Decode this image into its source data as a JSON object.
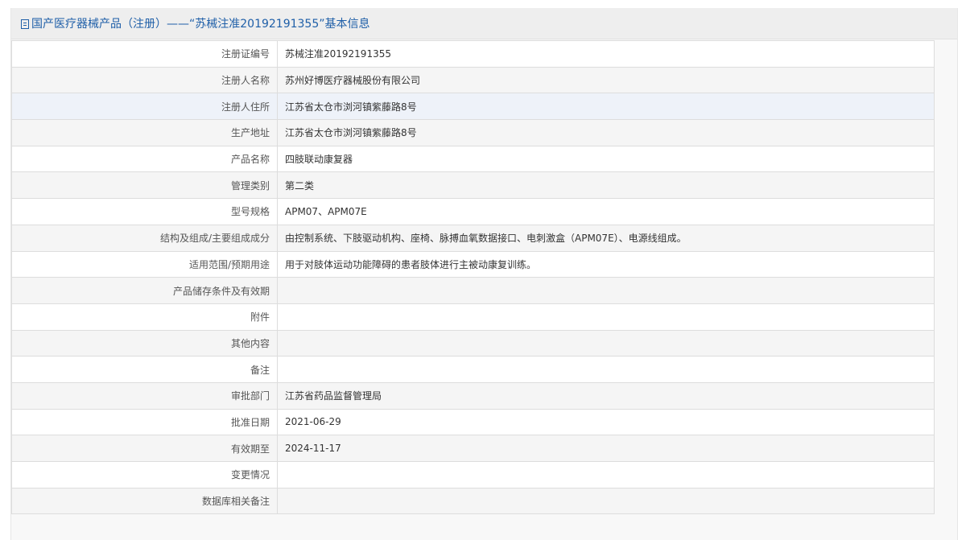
{
  "header": {
    "title": "国产医疗器械产品（注册）——“苏械注准20192191355”基本信息",
    "icon": "document-icon"
  },
  "colors": {
    "title": "#1f5fa8",
    "header_bg": "#eeeeee",
    "row_alt_bg": "#f5f5f5",
    "row_highlight_bg": "#eef2f9",
    "border": "#dddddd"
  },
  "rows": [
    {
      "label": "注册证编号",
      "value": "苏械注准20192191355"
    },
    {
      "label": "注册人名称",
      "value": "苏州好博医疗器械股份有限公司"
    },
    {
      "label": "注册人住所",
      "value": "江苏省太仓市浏河镇紫藤路8号"
    },
    {
      "label": "生产地址",
      "value": "江苏省太仓市浏河镇紫藤路8号"
    },
    {
      "label": "产品名称",
      "value": "四肢联动康复器"
    },
    {
      "label": "管理类别",
      "value": "第二类"
    },
    {
      "label": "型号规格",
      "value": "APM07、APM07E"
    },
    {
      "label": "结构及组成/主要组成成分",
      "value": "由控制系统、下肢驱动机构、座椅、脉搏血氧数据接口、电刺激盒（APM07E）、电源线组成。"
    },
    {
      "label": "适用范围/预期用途",
      "value": "用于对肢体运动功能障碍的患者肢体进行主被动康复训练。"
    },
    {
      "label": "产品储存条件及有效期",
      "value": ""
    },
    {
      "label": "附件",
      "value": ""
    },
    {
      "label": "其他内容",
      "value": ""
    },
    {
      "label": "备注",
      "value": ""
    },
    {
      "label": "审批部门",
      "value": "江苏省药品监督管理局"
    },
    {
      "label": "批准日期",
      "value": "2021-06-29"
    },
    {
      "label": "有效期至",
      "value": "2024-11-17"
    },
    {
      "label": "变更情况",
      "value": ""
    },
    {
      "label": "数据库相关备注",
      "value": ""
    }
  ]
}
